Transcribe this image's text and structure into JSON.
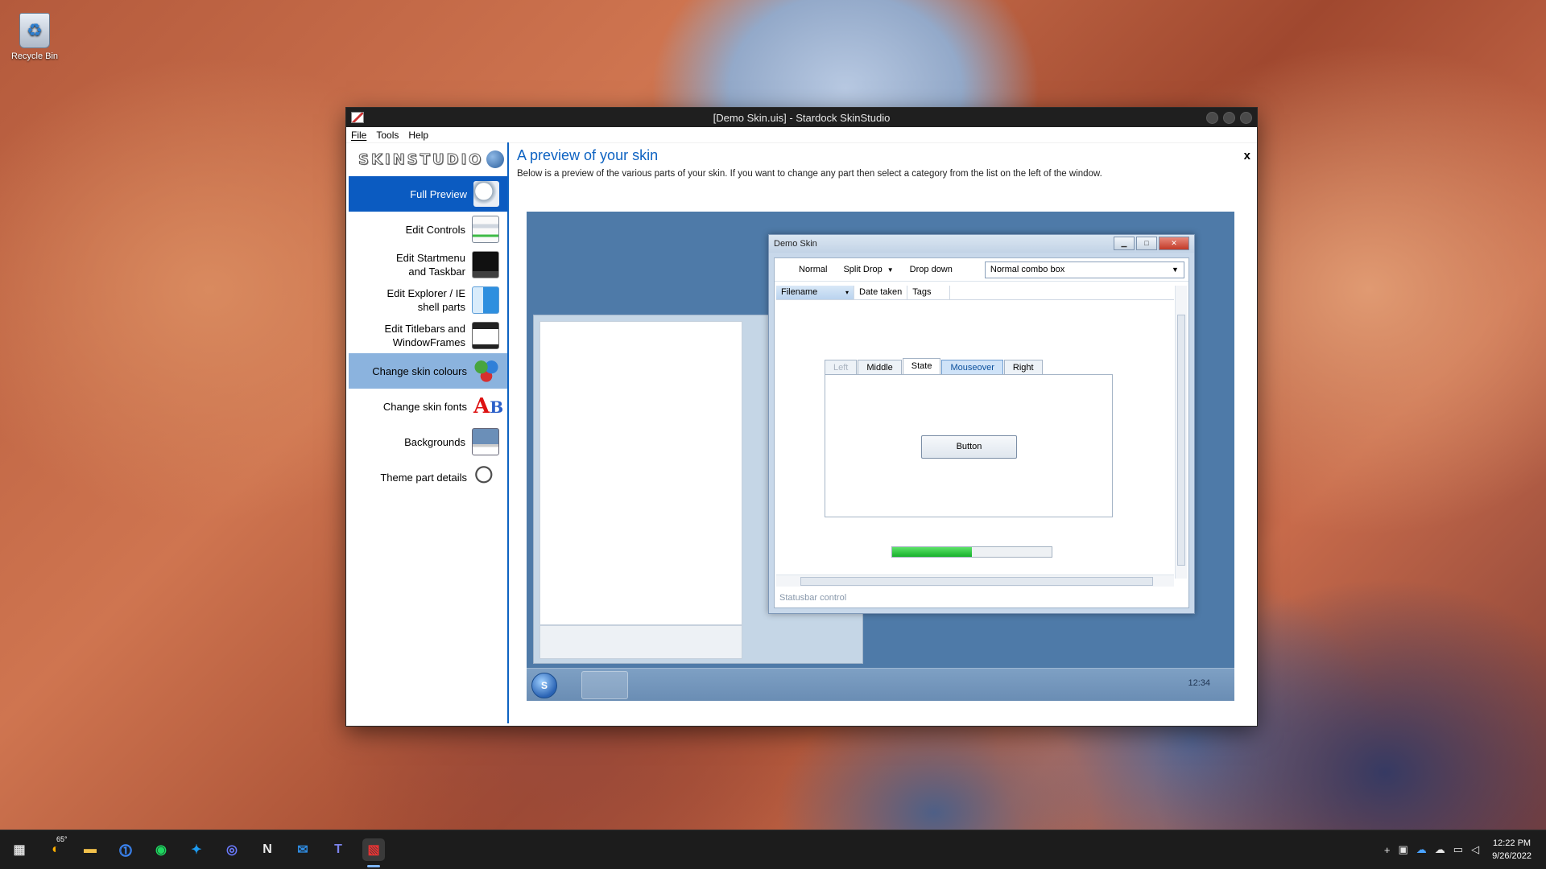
{
  "desktop": {
    "recycle_bin": "Recycle Bin"
  },
  "window": {
    "title": "[Demo Skin.uis] - Stardock SkinStudio",
    "menu": [
      "File",
      "Tools",
      "Help"
    ]
  },
  "sidebar": {
    "logo": "SKINSTUDIO",
    "items": [
      {
        "label": "Full Preview",
        "icon": "magnifier-preview-icon"
      },
      {
        "label": "Edit Controls",
        "icon": "controls-icon"
      },
      {
        "label": "Edit Startmenu and Taskbar",
        "icon": "startmenu-icon"
      },
      {
        "label": "Edit Explorer / IE shell parts",
        "icon": "explorer-icon"
      },
      {
        "label": "Edit Titlebars and WindowFrames",
        "icon": "titlebars-icon"
      },
      {
        "label": "Change skin colours",
        "icon": "colours-icon"
      },
      {
        "label": "Change skin fonts",
        "icon": "fonts-icon"
      },
      {
        "label": "Backgrounds",
        "icon": "backgrounds-icon"
      },
      {
        "label": "Theme part details",
        "icon": "magnifier-icon"
      }
    ]
  },
  "content": {
    "title": "A preview of your skin",
    "description": "Below is a preview of the various parts of your skin.  If you want to change any part then select a category from the list on the left of the window.",
    "close": "x"
  },
  "demo": {
    "title": "Demo Skin",
    "toolbar": {
      "normal": "Normal",
      "split_drop": "Split Drop",
      "dropdown": "Drop down",
      "combo_value": "Normal combo box"
    },
    "columns": [
      "Filename",
      "Date taken",
      "Tags"
    ],
    "tabs": [
      "Left",
      "Middle",
      "State",
      "Mouseover",
      "Right"
    ],
    "button": "Button",
    "progress_fraction": 0.5,
    "statusbar": "Statusbar control",
    "taskbar_clock": "12:34"
  },
  "taskbar": {
    "weather_temp": "65°",
    "time": "12:22 PM",
    "date": "9/26/2022",
    "accent": "#0b5bc1"
  }
}
